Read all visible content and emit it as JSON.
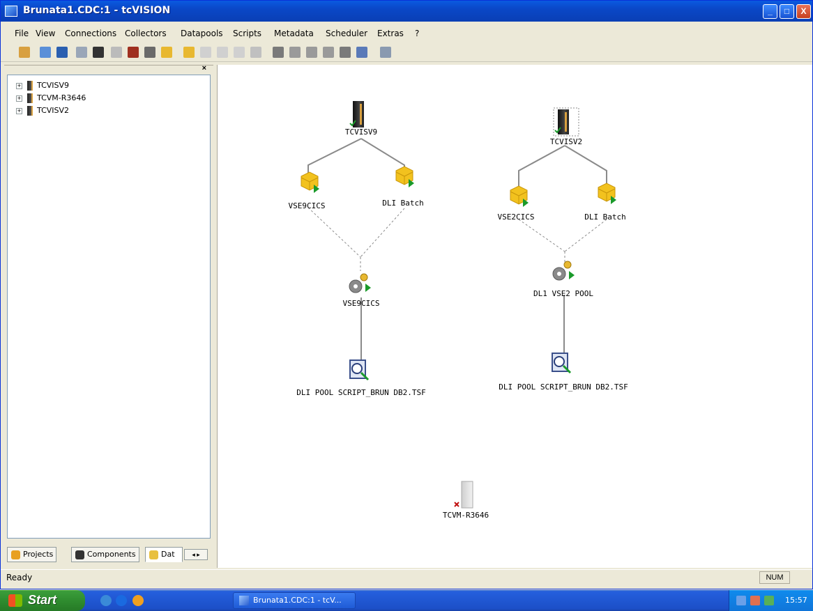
{
  "window": {
    "title": "Brunata1.CDC:1 - tcVISION",
    "controls": {
      "minimize": "_",
      "maximize": "□",
      "close": "X"
    }
  },
  "menu": [
    "File",
    "View",
    "Connections",
    "Collectors",
    "Datapools",
    "Scripts",
    "Metadata",
    "Scheduler",
    "Extras",
    "?"
  ],
  "sidebar": {
    "close_glyph": "×",
    "tree": [
      "TCVISV9",
      "TCVM-R3646",
      "TCVISV2"
    ],
    "expand_glyph": "+",
    "tabs": [
      "Projects",
      "Components",
      "Dat"
    ],
    "tab_scroll": "◂ ▸"
  },
  "diagram": {
    "group1": {
      "server": "TCVISV9",
      "collector_left": "VSE9CICS",
      "collector_right": "DLI Batch",
      "pool": "VSE9CICS",
      "script": "DLI POOL SCRIPT_BRUN DB2.TSF"
    },
    "group2": {
      "server": "TCVISV2",
      "collector_left": "VSE2CICS",
      "collector_right": "DLI Batch",
      "pool": "DL1 VSE2 POOL",
      "script": "DLI POOL SCRIPT_BRUN DB2.TSF"
    },
    "disconnected_server": "TCVM-R3646"
  },
  "status": {
    "text": "Ready",
    "num": "NUM"
  },
  "taskbar": {
    "start": "Start",
    "task": "Brunata1.CDC:1 - tcV...",
    "clock": "15:57"
  },
  "colors": {
    "titlebar": "#0a47c7",
    "box_yellow": "#f2c21e",
    "green_arrow": "#1a9a2a"
  }
}
